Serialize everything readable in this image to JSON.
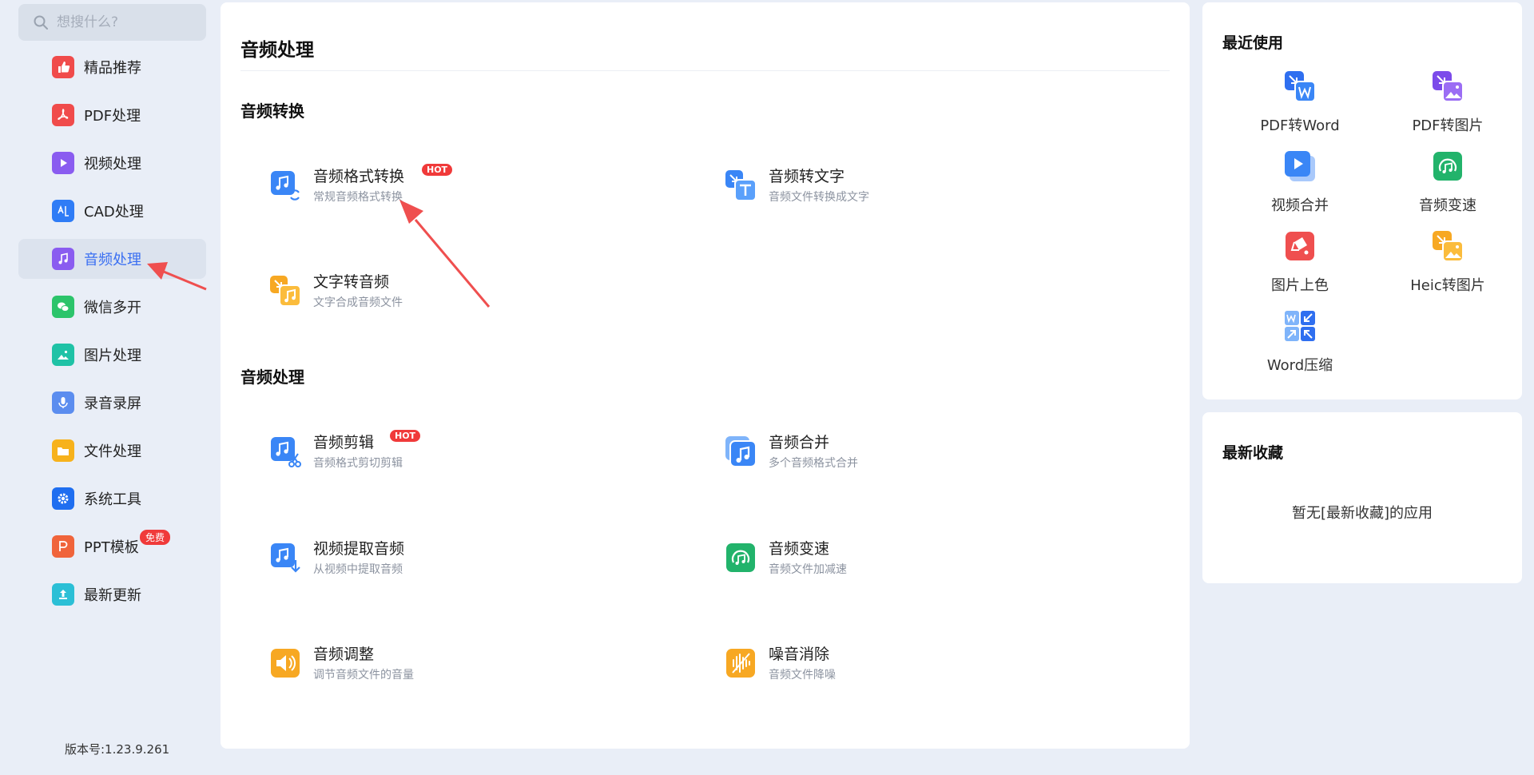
{
  "search": {
    "placeholder": "想搜什么?"
  },
  "sidebar": {
    "items": [
      {
        "label": "精品推荐",
        "icon": "thumbs-up-icon",
        "color": "#f04b4b"
      },
      {
        "label": "PDF处理",
        "icon": "pdf-icon",
        "color": "#f04b4b"
      },
      {
        "label": "视频处理",
        "icon": "play-icon",
        "color": "#8a5cf0"
      },
      {
        "label": "CAD处理",
        "icon": "cad-icon",
        "color": "#2f7cf6"
      },
      {
        "label": "音频处理",
        "icon": "music-icon",
        "color": "#8a5cf0"
      },
      {
        "label": "微信多开",
        "icon": "wechat-icon",
        "color": "#2cc46b"
      },
      {
        "label": "图片处理",
        "icon": "image-icon",
        "color": "#1fc2a6"
      },
      {
        "label": "录音录屏",
        "icon": "microphone-icon",
        "color": "#5b8def"
      },
      {
        "label": "文件处理",
        "icon": "folder-icon",
        "color": "#f7b21c"
      },
      {
        "label": "系统工具",
        "icon": "gear-icon",
        "color": "#1f6ef0"
      },
      {
        "label": "PPT模板",
        "icon": "ppt-icon",
        "color": "#f0643b",
        "badge": "免费"
      },
      {
        "label": "最新更新",
        "icon": "upload-icon",
        "color": "#2bbfd6"
      }
    ],
    "active_index": 4,
    "version": "版本号:1.23.9.261"
  },
  "main": {
    "title": "音频处理",
    "sections": [
      {
        "title": "音频转换",
        "tools": [
          {
            "name": "音频格式转换",
            "desc": "常规音频格式转换",
            "badge": "HOT",
            "icon": "audio-convert-icon"
          },
          {
            "name": "音频转文字",
            "desc": "音频文件转换成文字",
            "icon": "audio-to-text-icon"
          },
          {
            "name": "文字转音频",
            "desc": "文字合成音频文件",
            "icon": "text-to-audio-icon"
          }
        ]
      },
      {
        "title": "音频处理",
        "tools": [
          {
            "name": "音频剪辑",
            "desc": "音频格式剪切剪辑",
            "badge": "HOT",
            "icon": "audio-cut-icon"
          },
          {
            "name": "音频合并",
            "desc": "多个音频格式合并",
            "icon": "audio-merge-icon"
          },
          {
            "name": "视频提取音频",
            "desc": "从视频中提取音频",
            "icon": "video-extract-audio-icon"
          },
          {
            "name": "音频变速",
            "desc": "音频文件加减速",
            "icon": "audio-speed-icon"
          },
          {
            "name": "音频调整",
            "desc": "调节音频文件的音量",
            "icon": "volume-icon"
          },
          {
            "name": "噪音消除",
            "desc": "音频文件降噪",
            "icon": "noise-reduction-icon"
          }
        ]
      }
    ]
  },
  "recent": {
    "title": "最近使用",
    "items": [
      {
        "label": "PDF转Word",
        "icon": "pdf-to-word-icon"
      },
      {
        "label": "PDF转图片",
        "icon": "pdf-to-image-icon"
      },
      {
        "label": "视频合并",
        "icon": "video-merge-icon"
      },
      {
        "label": "音频变速",
        "icon": "audio-speed-icon"
      },
      {
        "label": "图片上色",
        "icon": "image-colorize-icon"
      },
      {
        "label": "Heic转图片",
        "icon": "heic-to-image-icon"
      },
      {
        "label": "Word压缩",
        "icon": "word-compress-icon"
      }
    ]
  },
  "favorites": {
    "title": "最新收藏",
    "empty_text": "暂无[最新收藏]的应用"
  }
}
